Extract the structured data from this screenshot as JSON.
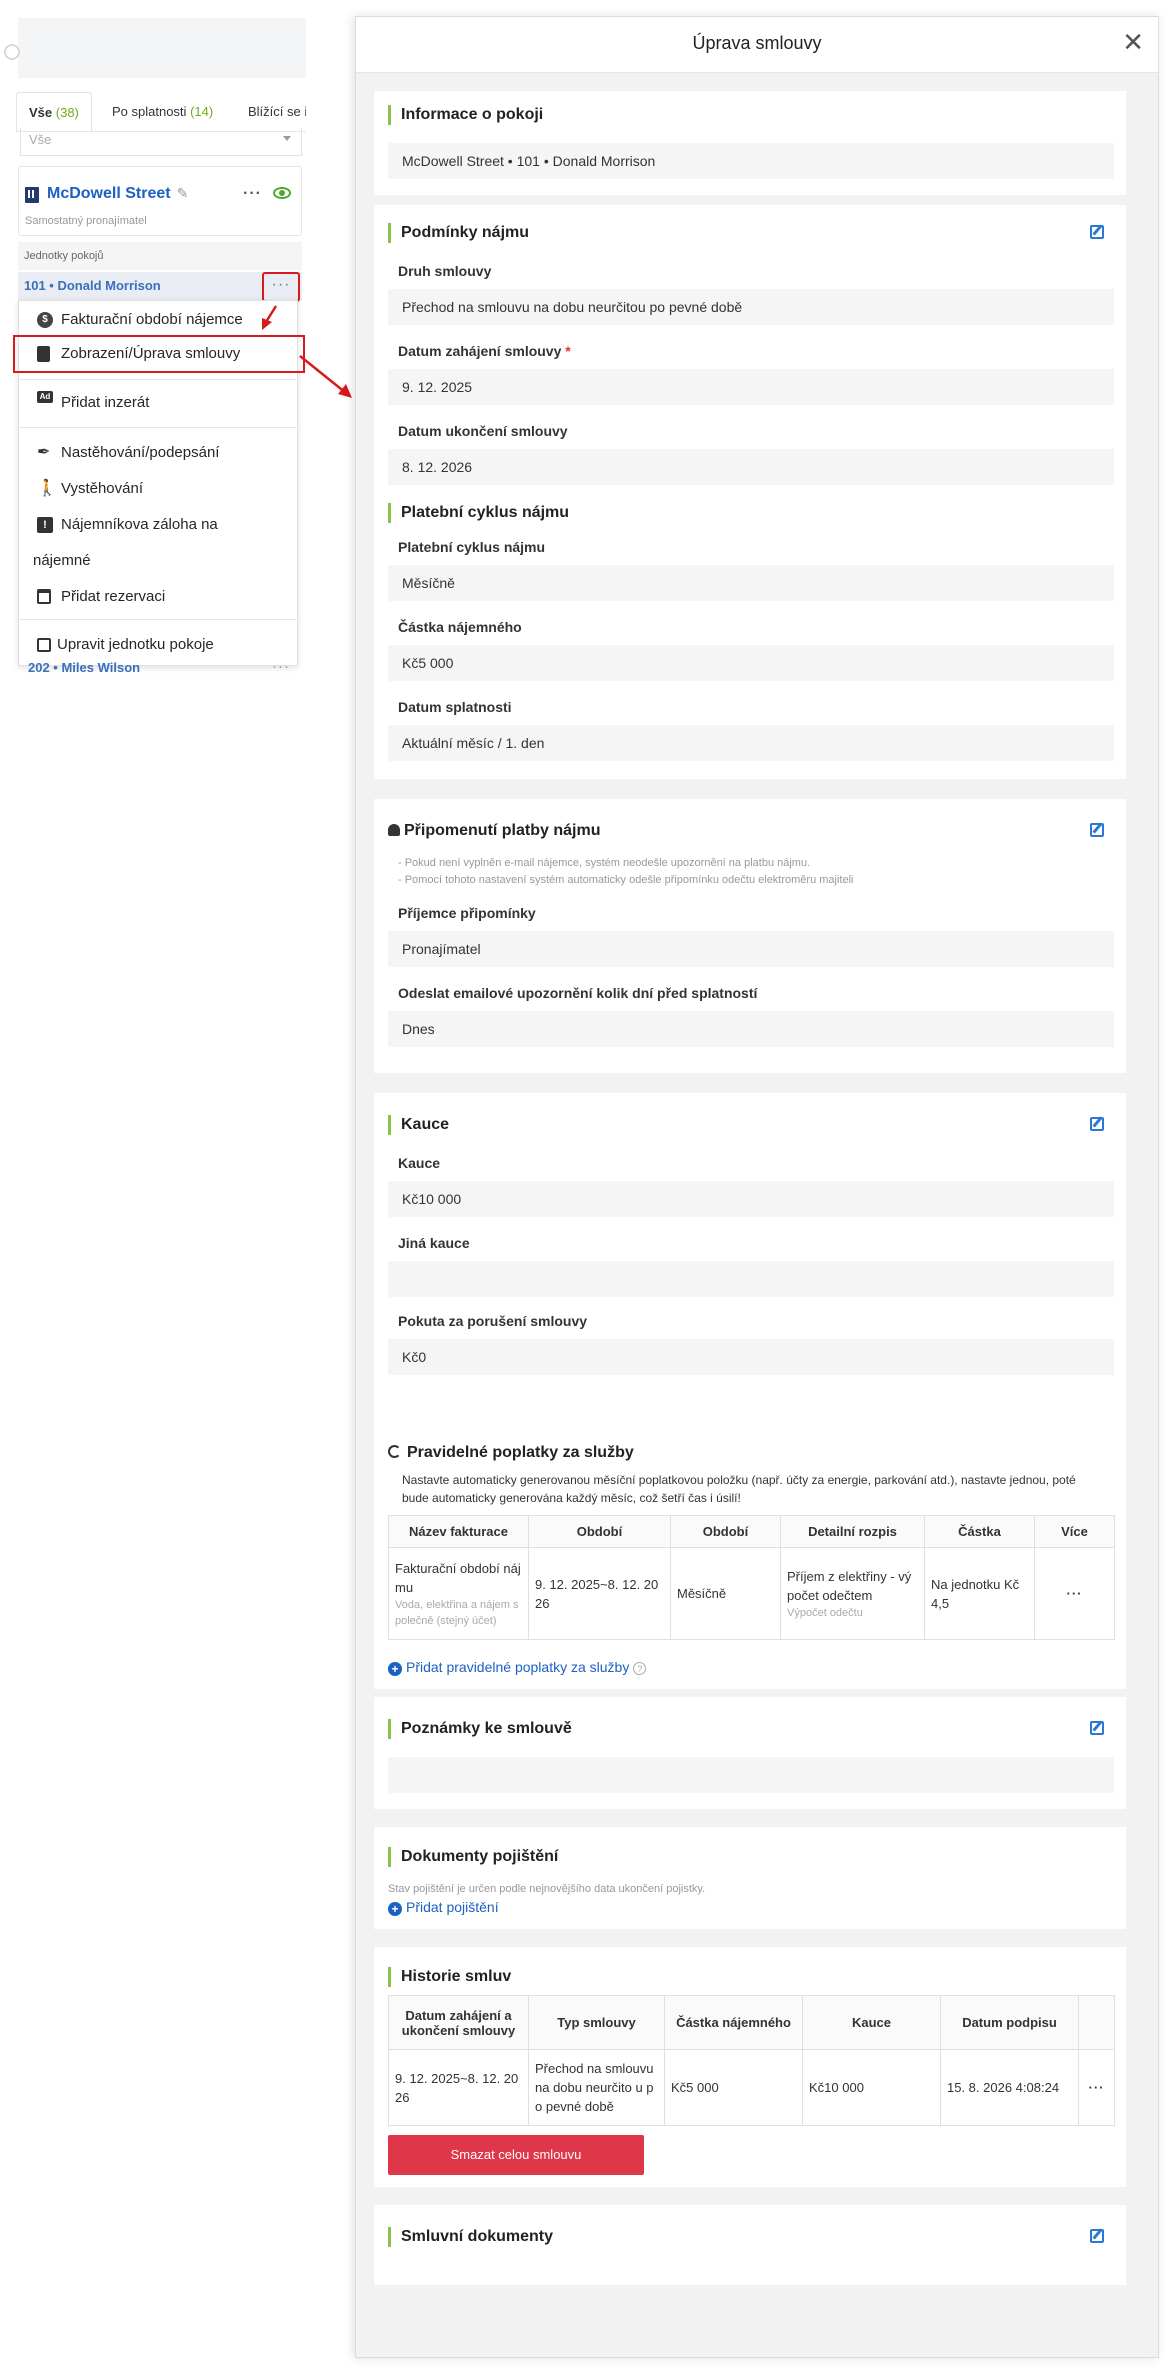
{
  "left": {
    "tabs": [
      {
        "label": "Vše",
        "count": "(38)"
      },
      {
        "label": "Po splatnosti",
        "count": "(14)"
      },
      {
        "label": "Blížící se i",
        "count": ""
      }
    ],
    "filter_value": "Vše",
    "property": {
      "name": "McDowell Street",
      "subtitle": "Samostatný pronajímatel"
    },
    "units_label": "Jednotky pokojů",
    "unit_row": "101 • Donald Morrison",
    "menu": [
      {
        "label": "Fakturační období nájemce",
        "icon": "dollar-icon"
      },
      {
        "label": "Zobrazení/Úprava smlouvy",
        "icon": "file-icon"
      },
      {
        "label": "Přidat inzerát",
        "icon": "ad-icon"
      },
      {
        "label": "Nastěhování/podepsání",
        "icon": "pen-icon"
      },
      {
        "label": "Vystěhování",
        "icon": "walk-icon"
      },
      {
        "label": "Nájemníkova záloha na",
        "label2": "nájemné",
        "icon": "deposit-icon"
      },
      {
        "label": "Přidat rezervaci",
        "icon": "calendar-icon"
      },
      {
        "label": "Upravit jednotku pokoje",
        "icon": "edit-icon"
      }
    ],
    "below_row": "202 • Miles Wilson"
  },
  "modal": {
    "title": "Úprava smlouvy",
    "room_info": {
      "title": "Informace o pokoji",
      "value": "McDowell Street • 101 • Donald Morrison"
    },
    "lease_terms": {
      "title": "Podmínky nájmu",
      "contract_type_label": "Druh smlouvy",
      "contract_type": "Přechod na smlouvu na dobu neurčitou po pevné době",
      "start_label": "Datum zahájení smlouvy",
      "start_required": "*",
      "start": "9. 12. 2025",
      "end_label": "Datum ukončení smlouvy",
      "end": "8. 12. 2026",
      "cycle_title": "Platební cyklus nájmu",
      "cycle_label": "Platební cyklus nájmu",
      "cycle": "Měsíčně",
      "amount_label": "Částka nájemného",
      "amount": "Kč5 000",
      "due_label": "Datum splatnosti",
      "due": "Aktuální měsíc / 1. den"
    },
    "reminder": {
      "title": "Připomenutí platby nájmu",
      "note1": "- Pokud není vyplněn e-mail nájemce, systém neodešle upozornění na platbu nájmu.",
      "note2": "- Pomocí tohoto nastavení systém automaticky odešle připomínku odečtu elektroměru majiteli",
      "recipient_label": "Příjemce připomínky",
      "recipient": "Pronajímatel",
      "days_label": "Odeslat emailové upozornění kolik dní před splatností",
      "days": "Dnes"
    },
    "deposit": {
      "title": "Kauce",
      "deposit_label": "Kauce",
      "deposit": "Kč10 000",
      "other_label": "Jiná kauce",
      "other": "",
      "penalty_label": "Pokuta za porušení smlouvy",
      "penalty": "Kč0"
    },
    "recurring": {
      "title": "Pravidelné poplatky za služby",
      "desc": "Nastavte automaticky generovanou měsíční poplatkovou položku (např. účty za energie, parkování atd.), nastavte jednou, poté bude automaticky generována každý měsíc, což šetří čas i úsilí!",
      "headers": [
        "Název fakturace",
        "Období",
        "Období",
        "Detailní rozpis",
        "Částka",
        "Více"
      ],
      "row": {
        "name": "Fakturační období nájmu",
        "name_sub": "Voda, elektřina a nájem společně (stejný účet)",
        "period": "9. 12. 2025~8. 12. 2026",
        "cycle": "Měsíčně",
        "detail": "Příjem z elektřiny - výpočet odečtem",
        "detail_sub": "Výpočet odečtu",
        "amount": "Na jednotku Kč4,5",
        "more": "···"
      },
      "add_link": "Přidat pravidelné poplatky za služby"
    },
    "notes": {
      "title": "Poznámky ke smlouvě",
      "value": ""
    },
    "insurance": {
      "title": "Dokumenty pojištění",
      "note": "Stav pojištění je určen podle nejnovějšího data ukončení pojistky.",
      "add_link": "Přidat pojištění"
    },
    "history": {
      "title": "Historie smluv",
      "headers": [
        "Datum zahájení a ukončení smlouvy",
        "Typ smlouvy",
        "Částka nájemného",
        "Kauce",
        "Datum podpisu",
        ""
      ],
      "row": {
        "period": "9. 12. 2025~8. 12. 2026",
        "type": "Přechod na smlouvu na dobu neurčito u po pevné době",
        "amount": "Kč5 000",
        "deposit": "Kč10 000",
        "signed": "15. 8. 2026 4:08:24",
        "more": "···"
      },
      "delete_button": "Smazat celou smlouvu"
    },
    "documents": {
      "title": "Smluvní dokumenty"
    }
  },
  "colors": {
    "accent_green": "#8bc34a",
    "link_blue": "#1d5fc2",
    "danger_red": "#e0364a",
    "highlight_red": "#d9191a"
  }
}
